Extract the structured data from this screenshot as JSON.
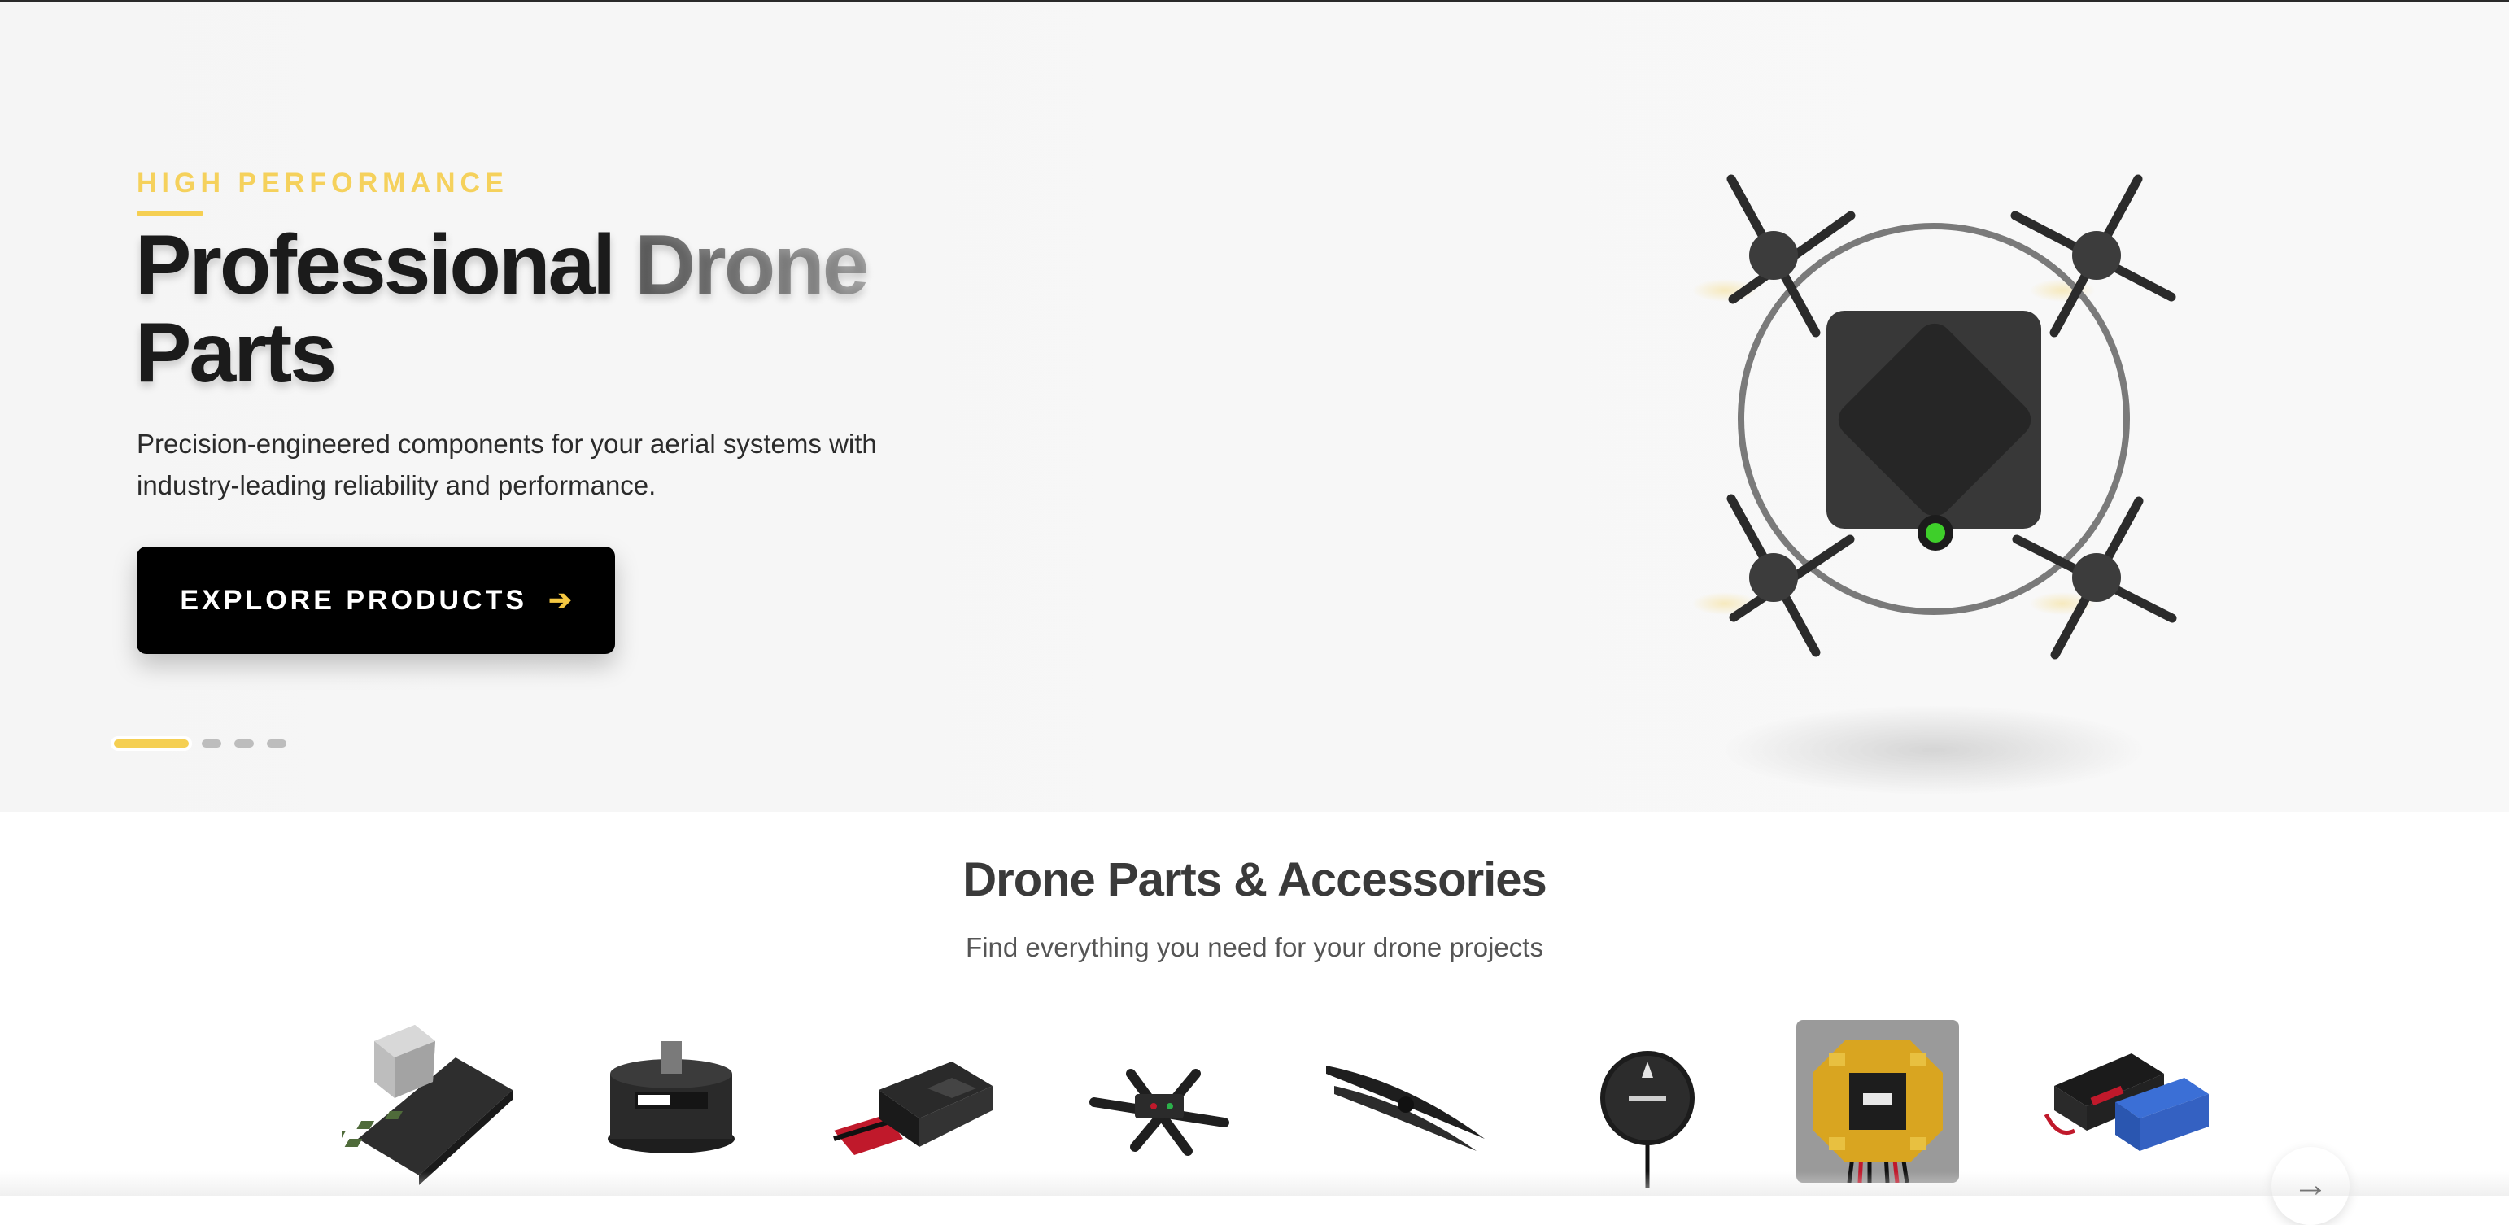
{
  "hero": {
    "eyebrow": "HIGH PERFORMANCE",
    "title_line1_a": "Professional",
    "title_line1_b": "Drone",
    "title_line2": "Parts",
    "subtitle": "Precision-engineered components for your aerial systems with industry-leading reliability and performance.",
    "cta_label": "EXPLORE PRODUCTS",
    "cta_arrow": "➔",
    "slides_total": 4,
    "active_slide": 1
  },
  "categories": {
    "title": "Drone Parts & Accessories",
    "subtitle": "Find everything you need for your drone projects",
    "items": [
      {
        "icon": "flight-controller-icon"
      },
      {
        "icon": "brushless-motor-icon"
      },
      {
        "icon": "esc-icon"
      },
      {
        "icon": "drone-frame-icon"
      },
      {
        "icon": "propeller-icon"
      },
      {
        "icon": "gps-module-icon"
      },
      {
        "icon": "power-distribution-board-icon",
        "selected": true
      },
      {
        "icon": "lipo-battery-icon"
      }
    ],
    "next_arrow": "→"
  },
  "colors": {
    "accent": "#f5cf52",
    "cta_bg": "#000000",
    "hero_bg": "#f6f6f6",
    "status_led": "#3ecf2a"
  }
}
